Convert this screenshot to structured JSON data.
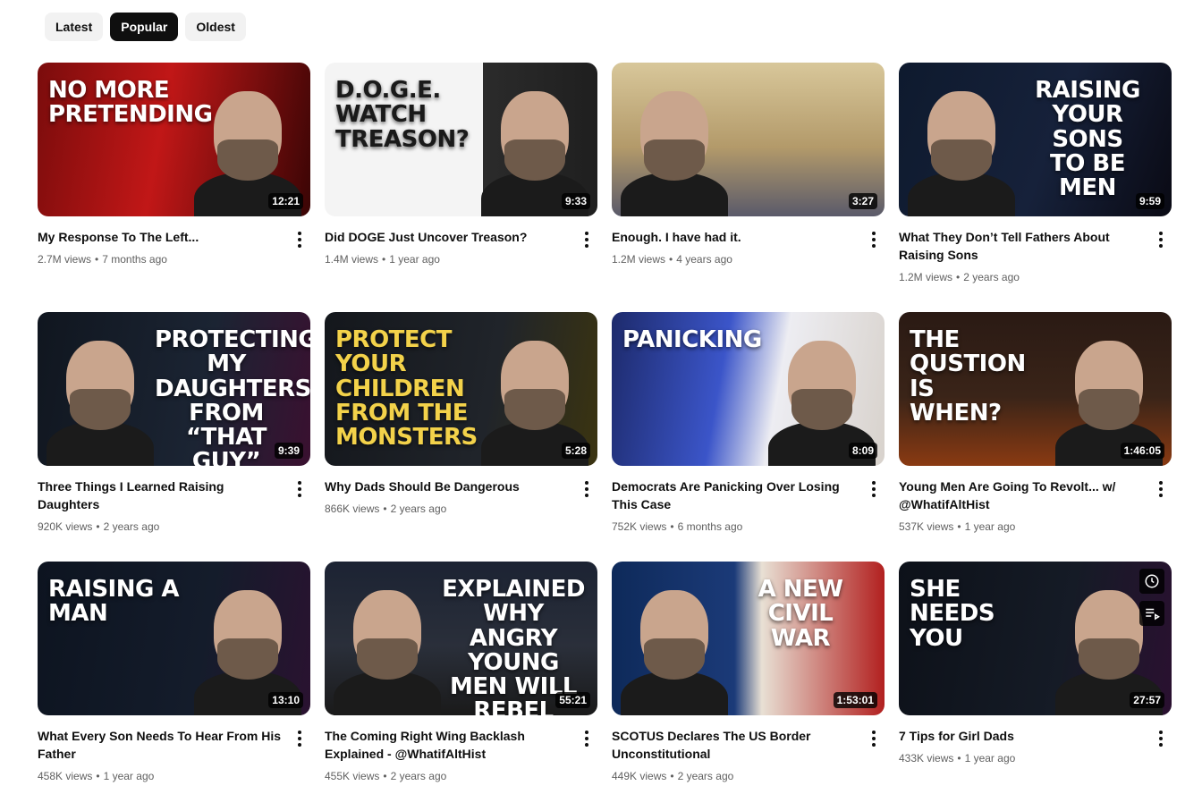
{
  "filters": {
    "chips": [
      "Latest",
      "Popular",
      "Oldest"
    ],
    "active": "Popular"
  },
  "videos": [
    {
      "title": "My Response To The Left...",
      "views": "2.7M views",
      "age": "7 months ago",
      "duration": "12:21",
      "thumb_text": "NO MORE\nPRETENDING",
      "thumb_bg": "linear-gradient(100deg,#7a0c0c 0%,#c11717 45%,#3a0505 100%)",
      "text_color": "#ffffff",
      "text_side": "left"
    },
    {
      "title": "Did DOGE Just Uncover Treason?",
      "views": "1.4M views",
      "age": "1 year ago",
      "duration": "9:33",
      "thumb_text": "D.O.G.E. WATCH\nTREASON?",
      "thumb_bg": "linear-gradient(90deg,#f4f4f4 0%,#f4f4f4 58%,#2b2b2b 58%,#1f1f1f 100%)",
      "text_color": "#1a1a1a",
      "text_side": "left"
    },
    {
      "title": "Enough. I have had it.",
      "views": "1.2M views",
      "age": "4 years ago",
      "duration": "3:27",
      "thumb_text": "",
      "thumb_bg": "linear-gradient(180deg,#d8c79a 0%,#b39a6a 55%,#5a5a6a 100%)",
      "text_color": "#ffffff",
      "text_side": "right"
    },
    {
      "title": "What They Don’t Tell Fathers About Raising Sons",
      "views": "1.2M views",
      "age": "2 years ago",
      "duration": "9:59",
      "thumb_text": "RAISING\nYOUR SONS\nTO BE\nMEN",
      "thumb_bg": "linear-gradient(110deg,#0e1a2e 0%,#16213a 55%,#0a0a14 100%)",
      "text_color": "#ffffff",
      "text_side": "right"
    },
    {
      "title": "Three Things I Learned Raising Daughters",
      "views": "920K views",
      "age": "2 years ago",
      "duration": "9:39",
      "thumb_text": "PROTECTING MY\nDAUGHTERS FROM\n“THAT GUY”",
      "thumb_bg": "linear-gradient(100deg,#10161f 0%,#1b2433 60%,#3a1030 100%)",
      "text_color": "#ffffff",
      "text_side": "right"
    },
    {
      "title": "Why Dads Should Be Dangerous",
      "views": "866K views",
      "age": "2 years ago",
      "duration": "5:28",
      "thumb_text": "PROTECT\nYOUR CHILDREN\nFROM THE\nMONSTERS",
      "thumb_bg": "linear-gradient(100deg,#14171c 0%,#20242a 60%,#3b3410 100%)",
      "text_color": "#f3d24a",
      "text_side": "left"
    },
    {
      "title": "Democrats Are Panicking Over Losing This Case",
      "views": "752K views",
      "age": "6 months ago",
      "duration": "8:09",
      "thumb_text": "PANICKING",
      "thumb_bg": "linear-gradient(100deg,#1d2a6b 0%,#3b55c9 40%,#ededf2 60%,#d8d2cc 100%)",
      "text_color": "#ffffff",
      "text_side": "left"
    },
    {
      "title": "Young Men Are Going To Revolt... w/ @WhatifAltHist",
      "views": "537K views",
      "age": "1 year ago",
      "duration": "1:46:05",
      "thumb_text": "THE QUSTION IS\nWHEN?",
      "thumb_bg": "linear-gradient(180deg,#2a1a14 0%,#3a2418 55%,#8a3a12 100%)",
      "text_color": "#ffffff",
      "text_side": "left"
    },
    {
      "title": "What Every Son Needs To Hear From His Father",
      "views": "458K views",
      "age": "1 year ago",
      "duration": "13:10",
      "thumb_text": "RAISING A\nMAN",
      "thumb_bg": "linear-gradient(100deg,#0d1420 0%,#141c2b 60%,#2a1230 100%)",
      "text_color": "#ffffff",
      "text_side": "left"
    },
    {
      "title": "The Coming Right Wing Backlash Explained - @WhatifAltHist",
      "views": "455K views",
      "age": "2 years ago",
      "duration": "55:21",
      "thumb_text": "EXPLAINED\nWhy Angry Young Men Will Rebel",
      "thumb_bg": "linear-gradient(180deg,#1c2333 0%,#2a2f3a 55%,#1a1a1a 100%)",
      "text_color": "#ffffff",
      "text_side": "right"
    },
    {
      "title": "SCOTUS Declares The US Border Unconstitutional",
      "views": "449K views",
      "age": "2 years ago",
      "duration": "1:53:01",
      "thumb_text": "A NEW\nCIVIL\nWAR",
      "thumb_bg": "linear-gradient(90deg,#0e2a5a 0%,#1b3a78 45%,#e8e0d4 55%,#b2201f 100%)",
      "text_color": "#ffffff",
      "text_side": "right"
    },
    {
      "title": "7 Tips for Girl Dads",
      "views": "433K views",
      "age": "1 year ago",
      "duration": "27:57",
      "thumb_text": "SHE NEEDS\nYOU",
      "thumb_bg": "linear-gradient(100deg,#0d1119 0%,#151b26 60%,#2a1030 100%)",
      "text_color": "#ffffff",
      "text_side": "left"
    }
  ],
  "hover_card_index": 11,
  "icons": {
    "more": "more-vert-icon",
    "watch_later": "clock-icon",
    "add_to_queue": "queue-icon"
  }
}
